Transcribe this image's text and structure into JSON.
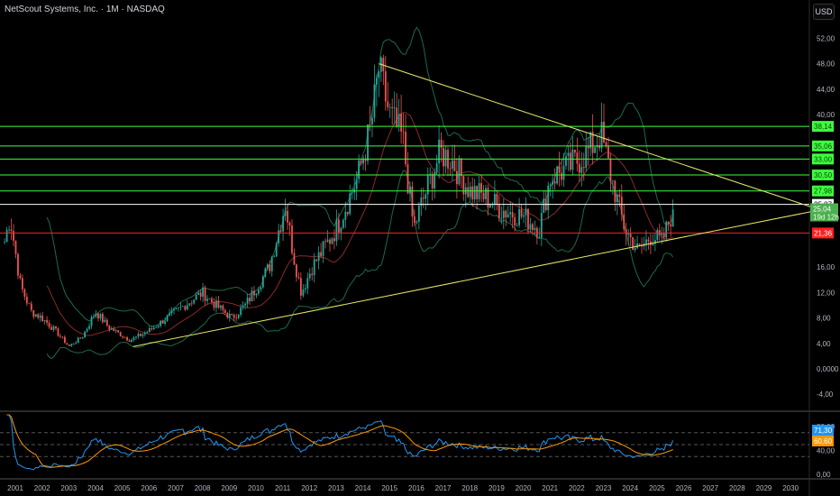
{
  "header": {
    "title": "NetScout Systems, Inc. · 1M · NASDAQ",
    "currency_button": "USD"
  },
  "chart_data": {
    "type": "candlestick",
    "title": "NetScout Systems, Inc. · 1M · NASDAQ",
    "interval": "1M",
    "price_axis": {
      "ticks": [
        "52,00",
        "48,00",
        "44,00",
        "40,00",
        "16,00",
        "12,00",
        "8,00",
        "4,00",
        "0,0000",
        "-4,00"
      ],
      "tick_values": [
        52,
        48,
        44,
        40,
        16,
        12,
        8,
        4,
        0,
        -4
      ],
      "range": [
        -6,
        58
      ]
    },
    "x_axis": {
      "ticks": [
        "2001",
        "2002",
        "2003",
        "2004",
        "2005",
        "2006",
        "2007",
        "2008",
        "2009",
        "2010",
        "2011",
        "2012",
        "2013",
        "2014",
        "2015",
        "2016",
        "2017",
        "2018",
        "2019",
        "2020",
        "2021",
        "2022",
        "2023",
        "2024",
        "2025",
        "2026",
        "2027",
        "2028",
        "2029",
        "2030"
      ]
    },
    "close_path": [
      [
        2000.6,
        20
      ],
      [
        2000.8,
        24
      ],
      [
        2001.2,
        13
      ],
      [
        2001.6,
        9
      ],
      [
        2002.0,
        8
      ],
      [
        2002.5,
        6
      ],
      [
        2003.0,
        3.5
      ],
      [
        2003.5,
        5
      ],
      [
        2004.0,
        9
      ],
      [
        2004.5,
        6.5
      ],
      [
        2005.3,
        4.5
      ],
      [
        2006.0,
        6
      ],
      [
        2007.0,
        9
      ],
      [
        2008.0,
        12
      ],
      [
        2008.5,
        10
      ],
      [
        2009.1,
        8
      ],
      [
        2009.6,
        10
      ],
      [
        2010.5,
        16
      ],
      [
        2011.1,
        26
      ],
      [
        2011.4,
        18
      ],
      [
        2011.7,
        12
      ],
      [
        2012.1,
        16
      ],
      [
        2013.0,
        22
      ],
      [
        2013.8,
        30
      ],
      [
        2014.3,
        38
      ],
      [
        2014.6,
        47
      ],
      [
        2015.0,
        40
      ],
      [
        2015.5,
        36
      ],
      [
        2015.9,
        22
      ],
      [
        2016.2,
        26
      ],
      [
        2016.9,
        34
      ],
      [
        2017.3,
        33
      ],
      [
        2018.0,
        28
      ],
      [
        2018.6,
        27
      ],
      [
        2019.2,
        25
      ],
      [
        2020.0,
        24
      ],
      [
        2020.6,
        22
      ],
      [
        2021.0,
        30
      ],
      [
        2021.8,
        32
      ],
      [
        2022.4,
        34
      ],
      [
        2022.9,
        37
      ],
      [
        2023.3,
        30
      ],
      [
        2023.8,
        22
      ],
      [
        2024.3,
        18.5
      ],
      [
        2024.8,
        21
      ],
      [
        2025.2,
        20
      ],
      [
        2025.6,
        25.04
      ]
    ],
    "horizontal_levels": [
      {
        "value": 38.14,
        "label": "38,14",
        "color": "#3cff3c"
      },
      {
        "value": 35.06,
        "label": "35,06",
        "color": "#3cff3c"
      },
      {
        "value": 33.0,
        "label": "33,00",
        "color": "#3cff3c"
      },
      {
        "value": 30.5,
        "label": "30,50",
        "color": "#3cff3c"
      },
      {
        "value": 27.98,
        "label": "27,98",
        "color": "#3cff3c"
      },
      {
        "value": 25.87,
        "label": "25,87",
        "color": "#ffffff"
      },
      {
        "value": 21.36,
        "label": "21,36",
        "color": "#ff2020"
      }
    ],
    "last_price": {
      "value": 25.04,
      "label": "25,04",
      "countdown": "19d 12h",
      "color": "#4caf50"
    },
    "trendlines": [
      {
        "from": [
          2014.6,
          48
        ],
        "to": [
          2031.1,
          25
        ]
      },
      {
        "from": [
          2005.4,
          3.5
        ],
        "to": [
          2031.1,
          25
        ]
      }
    ],
    "rsi": {
      "ticks": [
        "80,00",
        "40,00",
        "0,00"
      ],
      "tick_values": [
        80,
        40,
        0
      ],
      "levels": [
        70,
        50,
        30
      ],
      "rsi_value": "71,30",
      "ma_value": "60,60",
      "rsi_color": "#2196f3",
      "ma_color": "#ff9800"
    },
    "colors": {
      "up": "#26a69a",
      "down": "#ef5350",
      "bb": "#1b6b4a",
      "basis": "#8b2a2a",
      "trend": "#e6e66a"
    }
  }
}
